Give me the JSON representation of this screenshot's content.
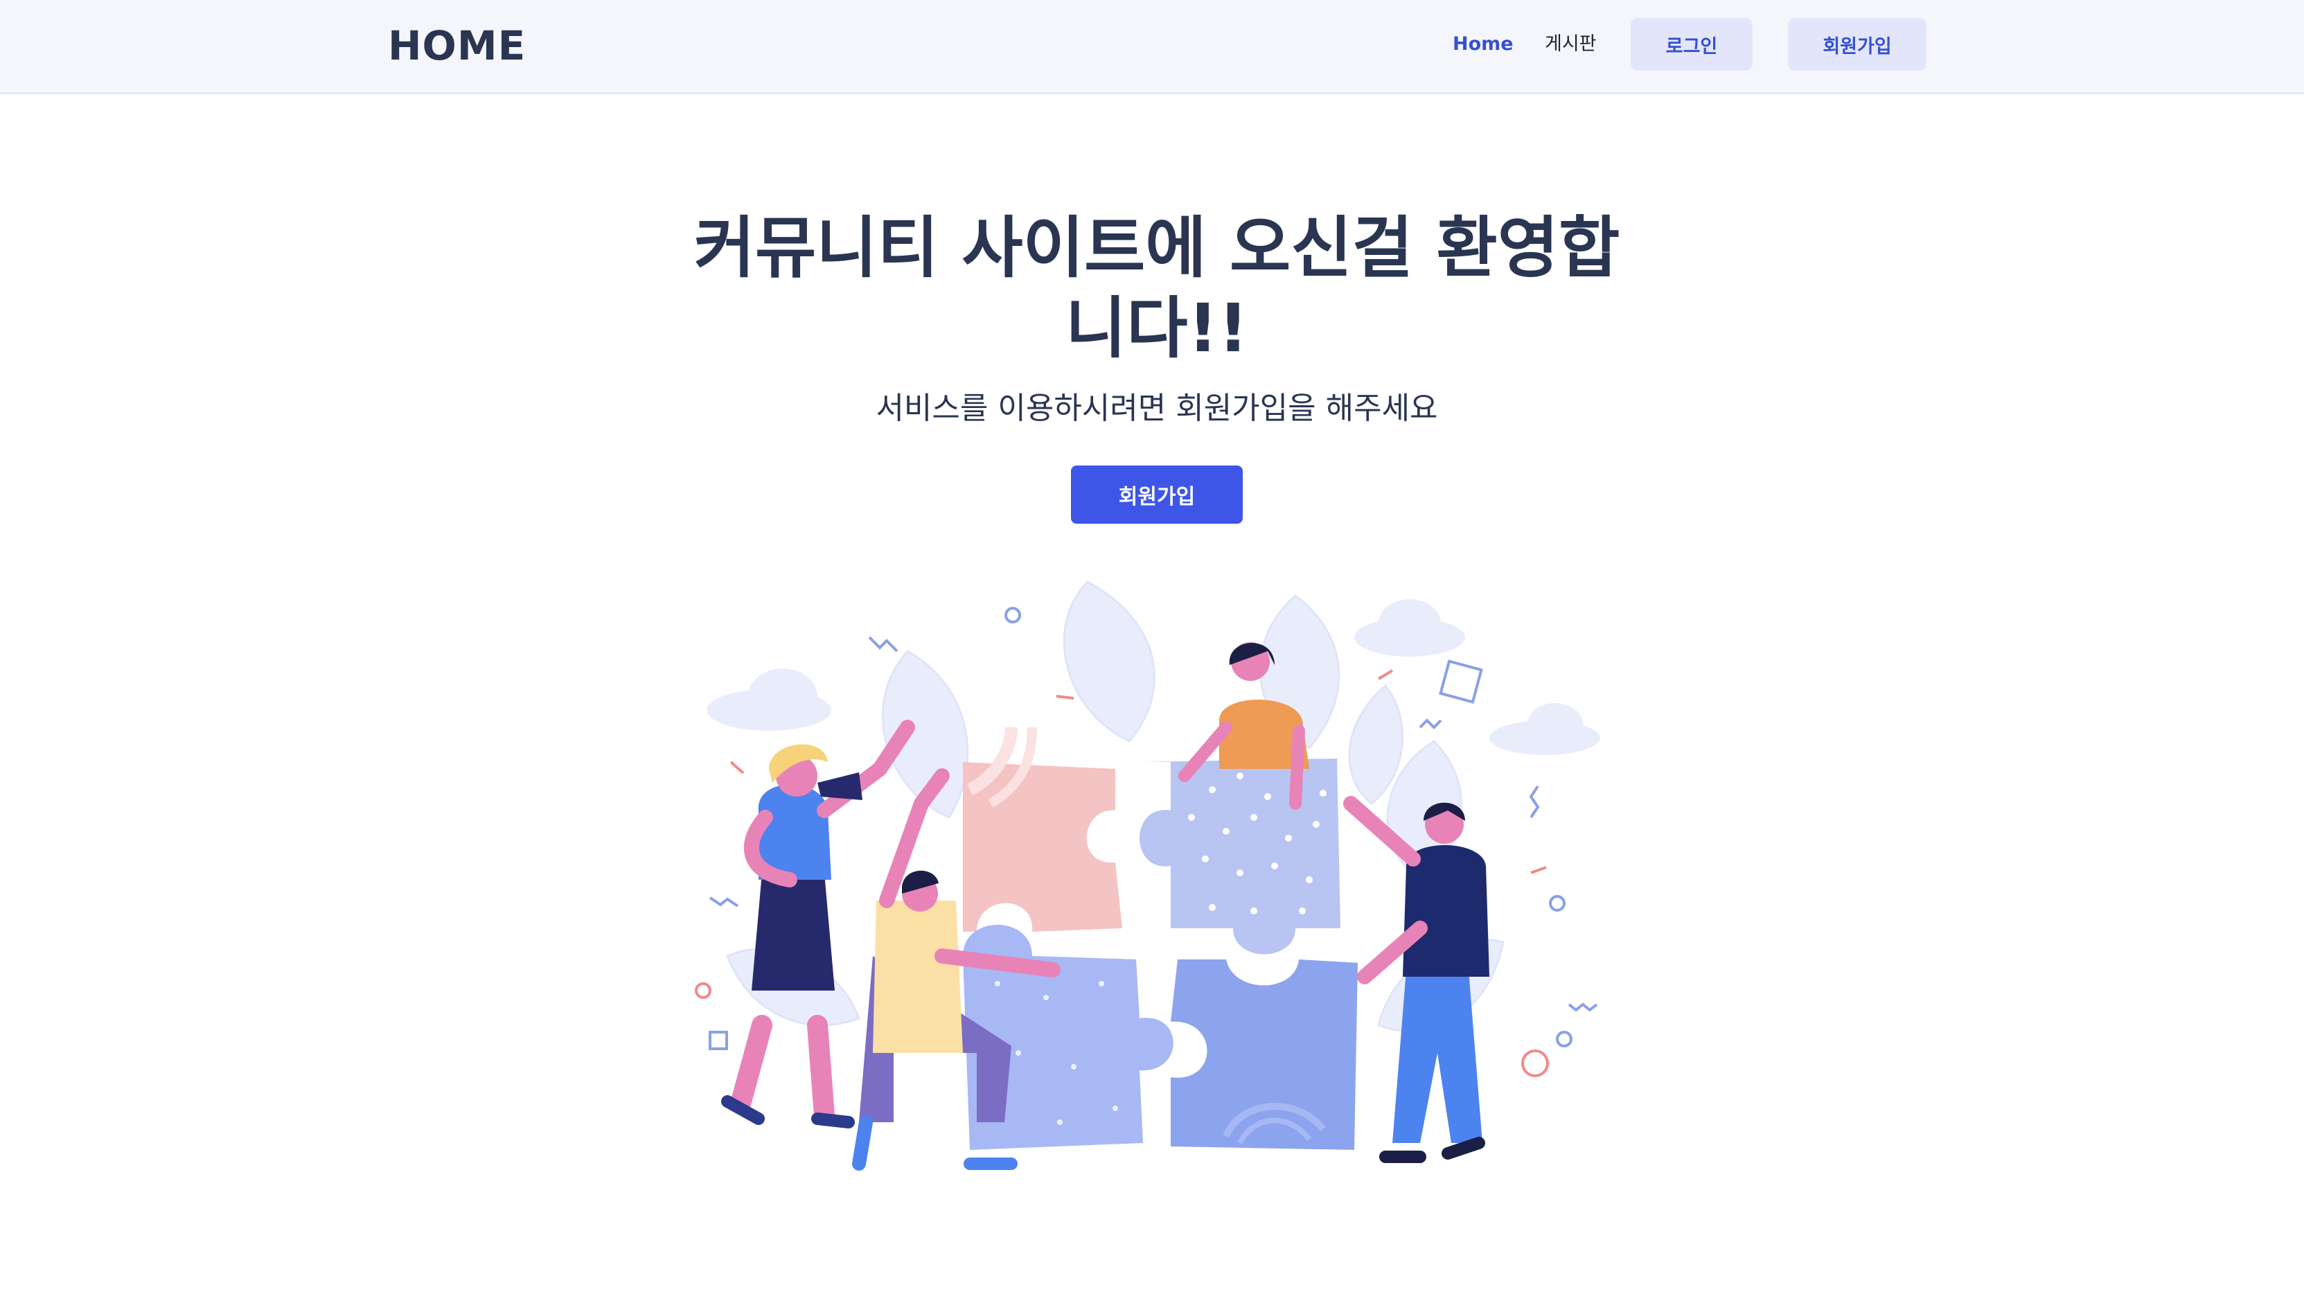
{
  "navbar": {
    "brand": "HOME",
    "links": {
      "home": "Home",
      "board": "게시판"
    },
    "buttons": {
      "login": "로그인",
      "signup": "회원가입"
    }
  },
  "hero": {
    "title": "커뮤니티 사이트에 오신걸 환영합니다!!",
    "subtitle": "서비스를 이용하시려면 회원가입을 해주세요",
    "cta": "회원가입"
  },
  "colors": {
    "primary": "#3d56e8",
    "brand_text": "#2a3552",
    "nav_bg": "#f5f6fc",
    "nav_button_bg": "#e3e6fa"
  },
  "illustration": {
    "icon": "team-puzzle-illustration"
  }
}
